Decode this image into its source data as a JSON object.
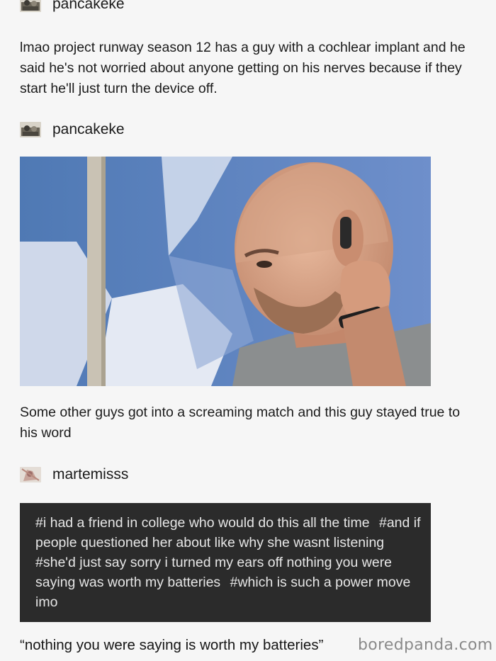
{
  "posts": [
    {
      "username": "pancakeke",
      "text": "lmao project runway season 12 has a guy with a cochlear implant and he said he's not worried about anyone getting on his nerves because if they start he'll just turn the device off."
    },
    {
      "username": "pancakeke",
      "text": "Some other guys got into a screaming match and this guy stayed true to his word"
    },
    {
      "username": "martemisss"
    }
  ],
  "tags": [
    "#i had a friend in college who would do this all the time",
    "#and if people questioned her about like why she wasnt listening",
    "#she'd just say sorry i turned my ears off nothing you were saying was worth my batteries",
    "#which is such a power move imo"
  ],
  "caption": "“nothing you were saying is worth my batteries”",
  "watermark": "boredpanda.com"
}
